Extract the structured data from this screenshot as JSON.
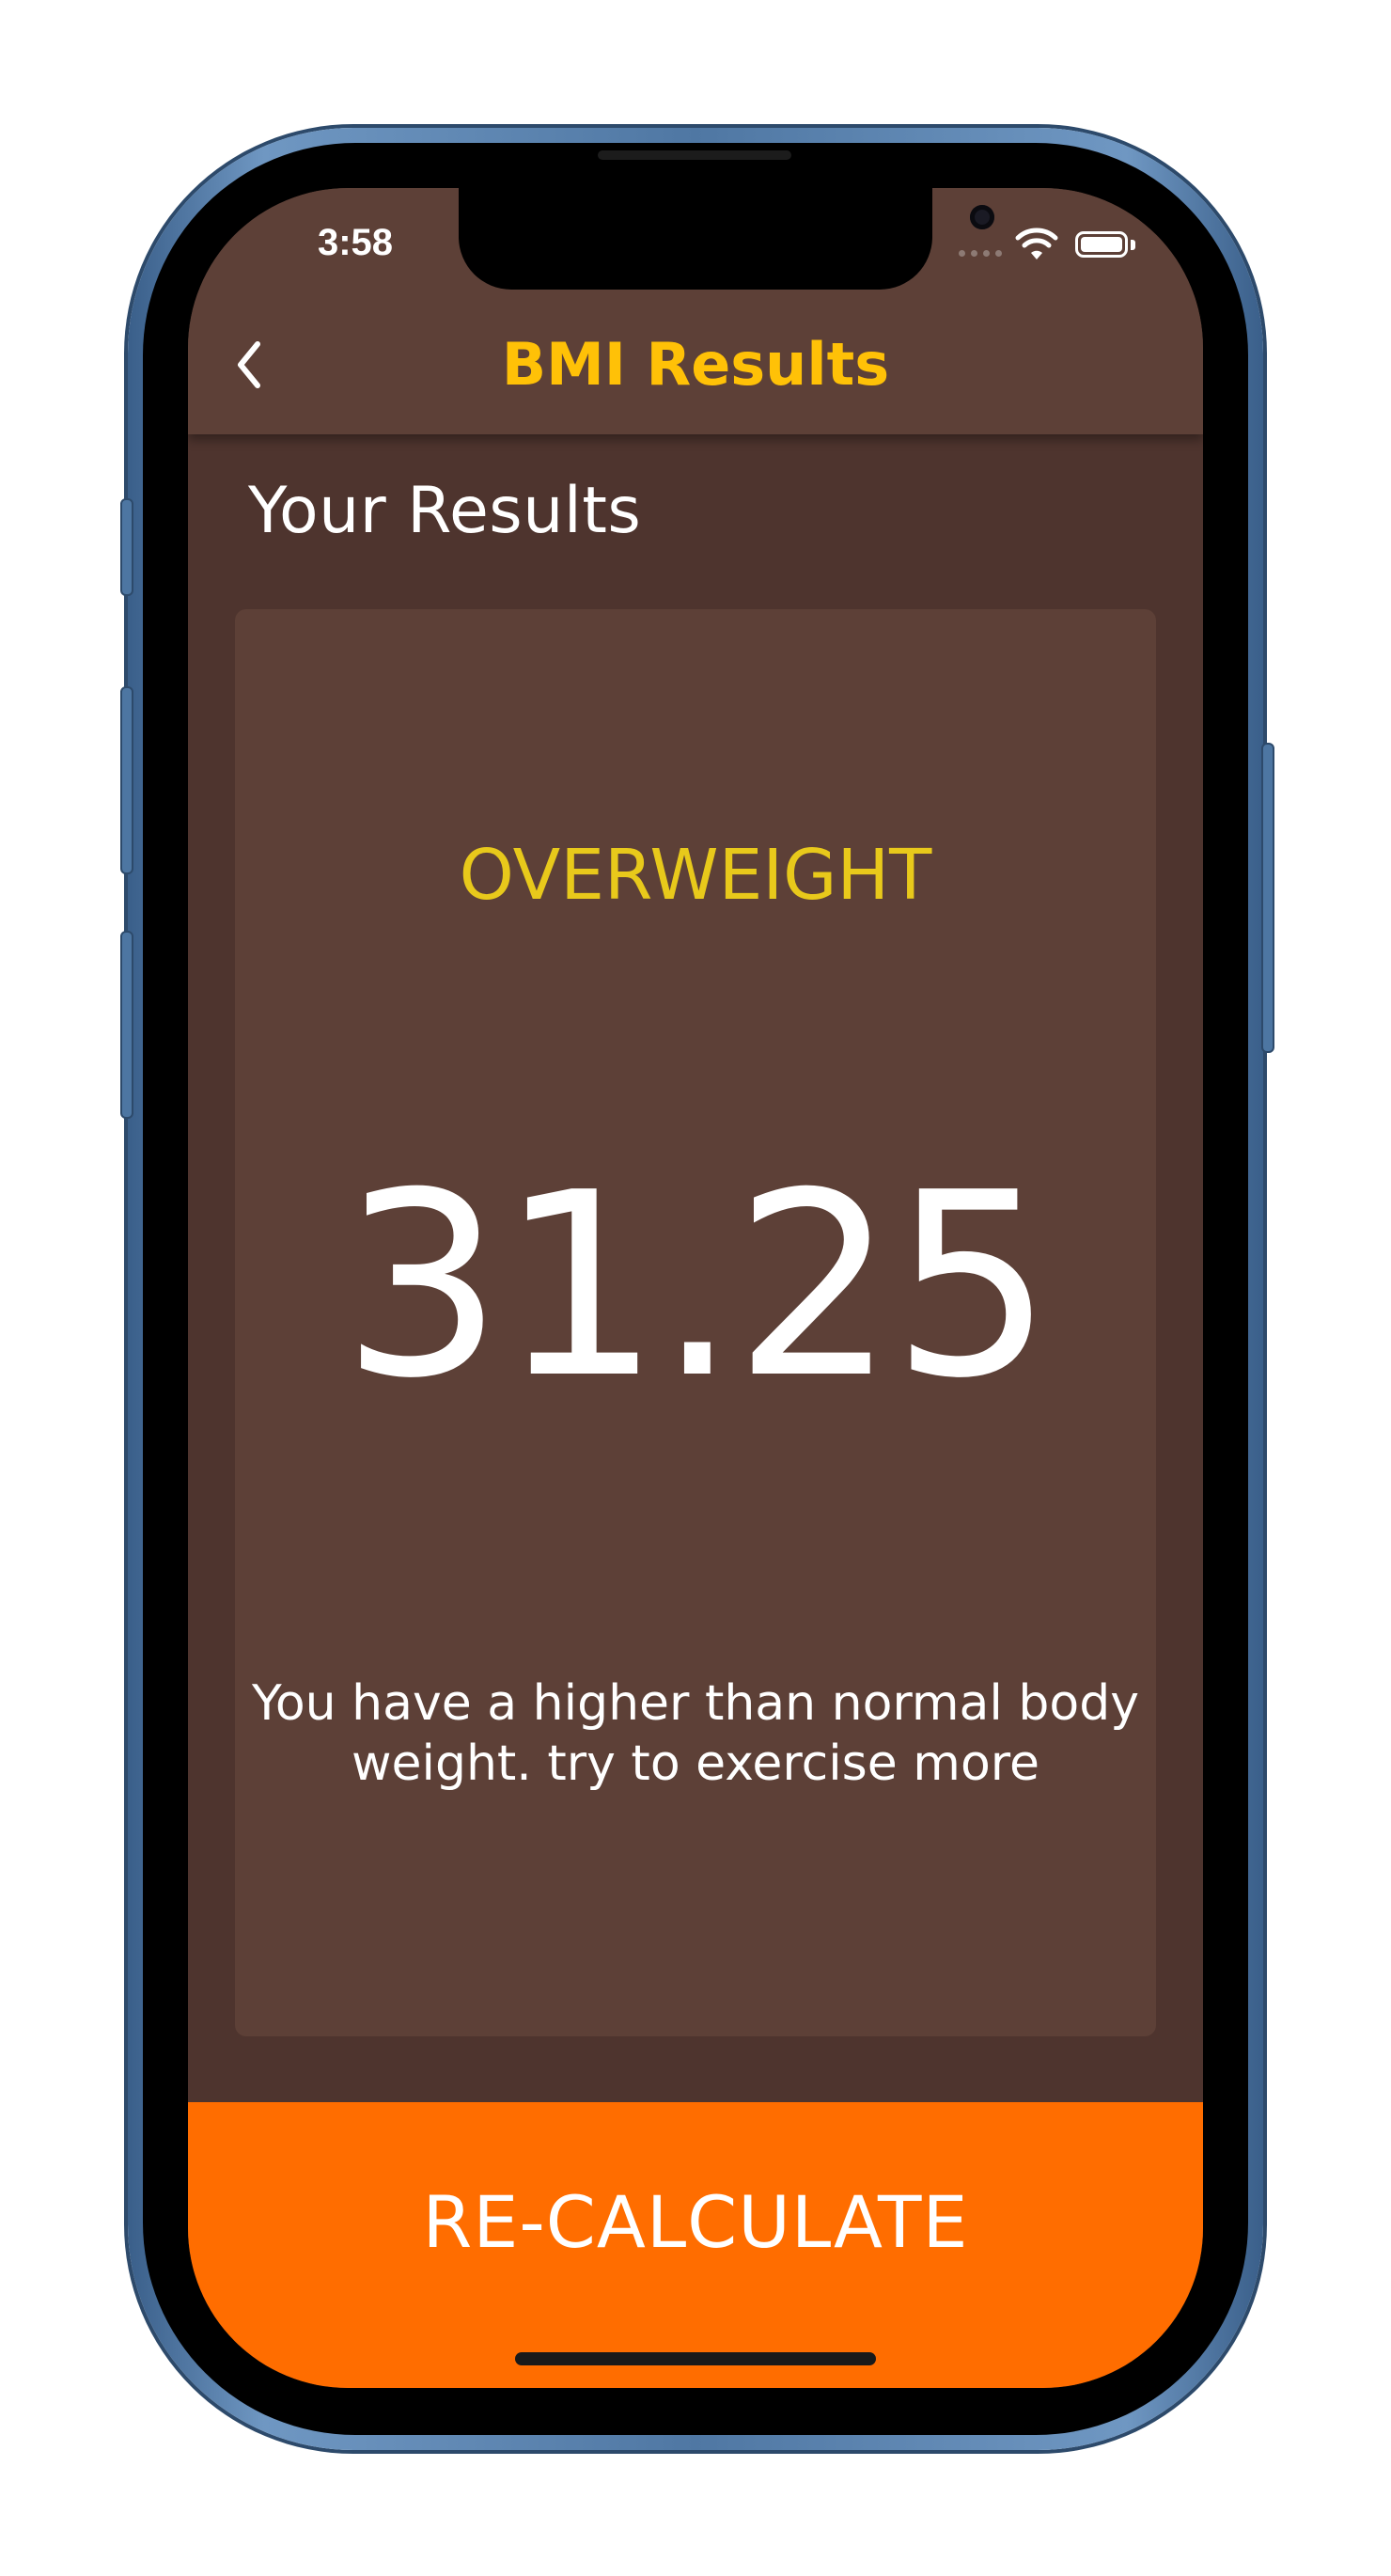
{
  "status_bar": {
    "time": "3:58",
    "wifi_icon": "wifi-icon",
    "battery_icon": "battery-icon",
    "battery_level": 1.0
  },
  "app_bar": {
    "title": "BMI Results",
    "back_icon": "chevron-left-icon"
  },
  "page": {
    "heading": "Your Results"
  },
  "result": {
    "category": "OVERWEIGHT",
    "bmi_value": "31.25",
    "message": "You have a higher than normal body weight. try to exercise more"
  },
  "action": {
    "recalculate_label": "RE-CALCULATE"
  },
  "colors": {
    "app_bar_background": "#5d4037",
    "page_background": "#4e342e",
    "card_background": "#5d4037",
    "title_accent": "#ffc107",
    "category_text": "#e8c91b",
    "button_background": "#ff6d00",
    "device_frame": "#4f77a3"
  }
}
